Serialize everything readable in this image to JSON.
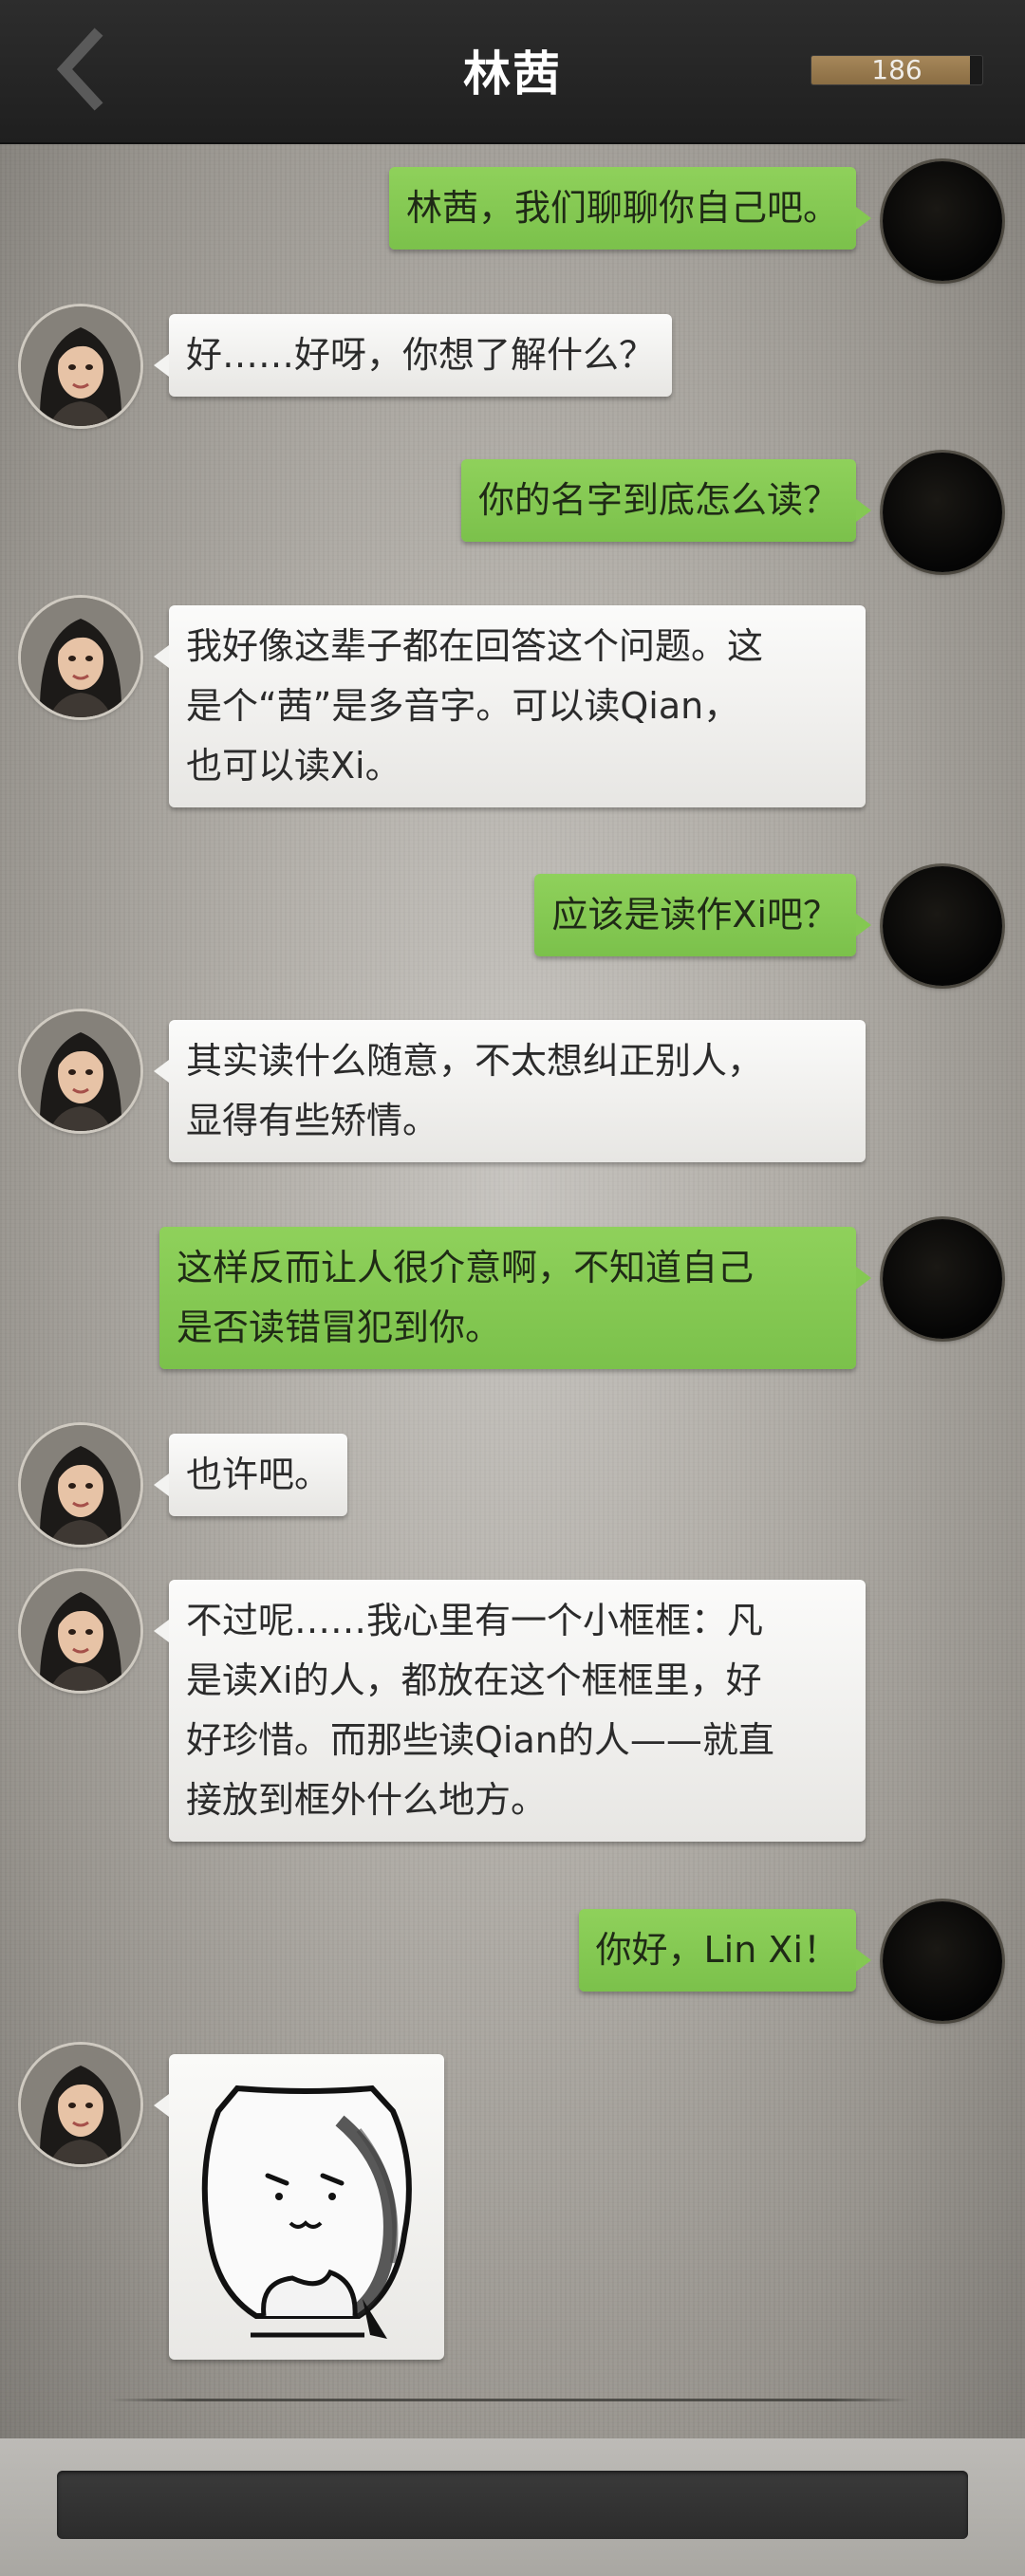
{
  "header": {
    "title": "林茜",
    "score": "186",
    "score_progress": 0.93
  },
  "messages": [
    {
      "side": "out",
      "text": "林茜，我们聊聊你自己吧。"
    },
    {
      "side": "in",
      "text": "好……好呀，你想了解什么？"
    },
    {
      "side": "out",
      "text": "你的名字到底怎么读？"
    },
    {
      "side": "in",
      "lines": [
        "我好像这辈子都在回答这个问题。这",
        "是个“茜”是多音字。可以读Qian，",
        "也可以读Xi。"
      ]
    },
    {
      "side": "out",
      "text": "应该是读作Xi吧？"
    },
    {
      "side": "in",
      "lines": [
        "其实读什么随意，不太想纠正别人，",
        "显得有些矫情。"
      ]
    },
    {
      "side": "out",
      "lines": [
        "这样反而让人很介意啊，不知道自己",
        "是否读错冒犯到你。"
      ]
    },
    {
      "side": "in",
      "text": "也许吧。"
    },
    {
      "side": "in",
      "lines": [
        "不过呢……我心里有一个小框框：凡",
        "是读Xi的人，都放在这个框框里，好",
        "好珍惜。而那些读Qian的人——就直",
        "接放到框外什么地方。"
      ]
    },
    {
      "side": "out",
      "text": "你好，Lin Xi！"
    },
    {
      "side": "in",
      "sticker": "cat-sticker"
    }
  ],
  "icons": {
    "back": "chevron-left-icon",
    "user_avatar": "dark-avatar-icon",
    "contact_avatar": "girl-avatar-icon"
  },
  "colors": {
    "header_bg": "#262626",
    "bubble_out": "#84c852",
    "bubble_in": "#f3f3f1",
    "score_fill": "#9a7b50"
  }
}
